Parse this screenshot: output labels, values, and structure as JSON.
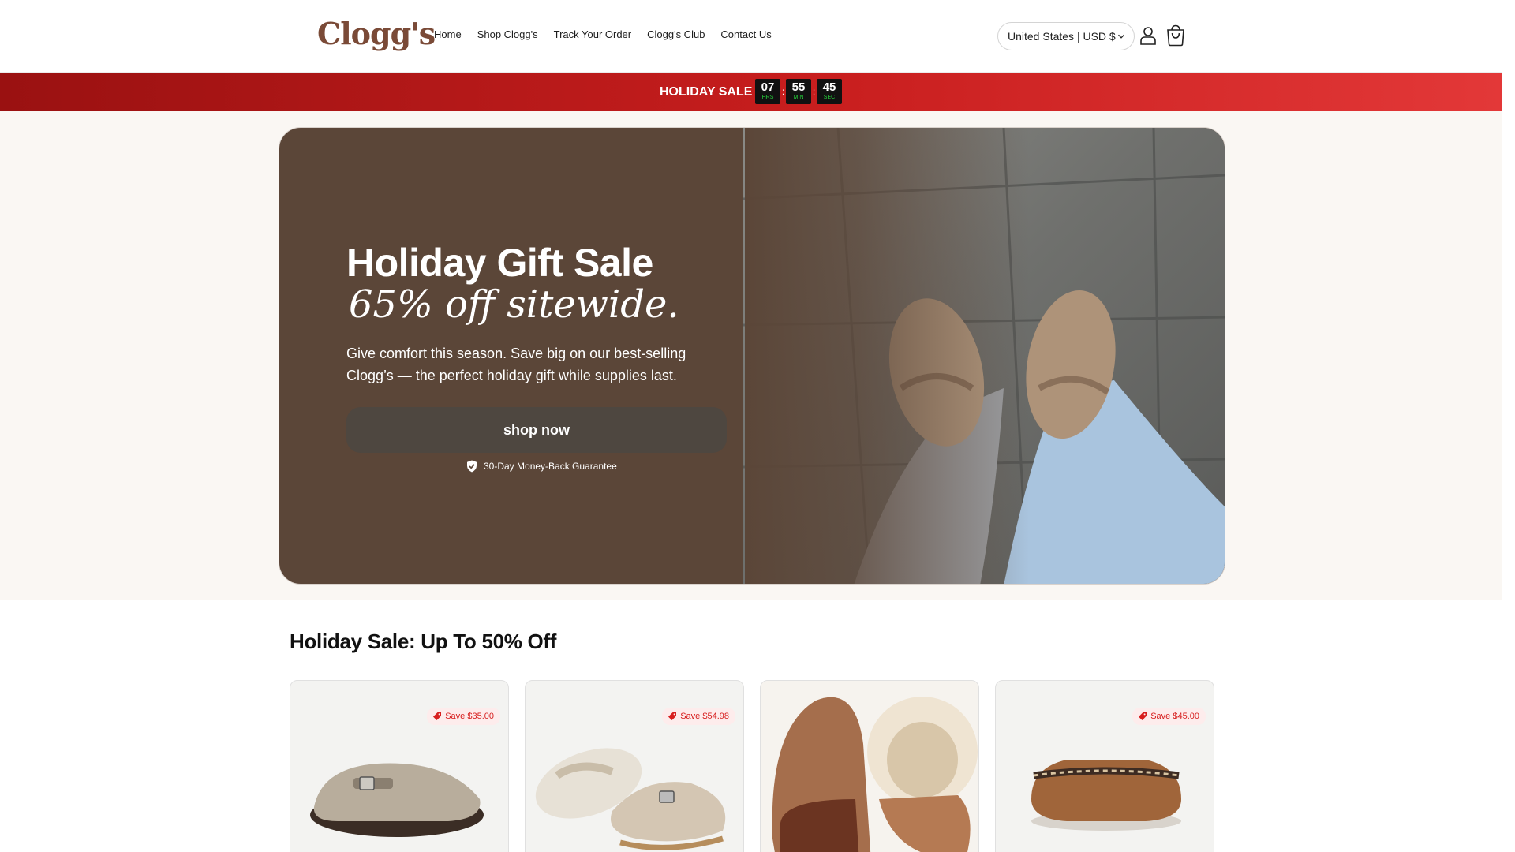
{
  "header": {
    "logo": "Clogg's",
    "nav": [
      "Home",
      "Shop Clogg's",
      "Track Your Order",
      "Clogg's Club",
      "Contact Us"
    ],
    "country_selector": "United States | USD $",
    "account_icon": "user-icon",
    "cart_icon": "shopping-bag-icon"
  },
  "sale_bar": {
    "label": "HOLIDAY SALE",
    "timer": [
      {
        "value": "07",
        "unit": "HRS"
      },
      {
        "value": "55",
        "unit": "MIN"
      },
      {
        "value": "45",
        "unit": "SEC"
      }
    ],
    "colors": {
      "bar_from": "#9a1111",
      "bar_to": "#e33838",
      "unit_text": "#27d23b"
    }
  },
  "hero": {
    "title": "Holiday Gift Sale",
    "subtitle": "65% off sitewide.",
    "description": "Give comfort this season. Save big on our best-selling Clogg’s — the perfect holiday gift while supplies last.",
    "button": "shop now",
    "guarantee": "30-Day Money-Back Guarantee",
    "colors": {
      "panel": "#5b4638"
    }
  },
  "products_section": {
    "title": "Holiday Sale: Up To 50% Off",
    "products": [
      {
        "badge": "Save $35.00",
        "image": "taupe-suede-clog"
      },
      {
        "badge": "Save $54.98",
        "image": "clog-pair-patterned-sole"
      },
      {
        "badge": "",
        "image": "shearling-slipper-pair"
      },
      {
        "badge": "Save $45.00",
        "image": "chestnut-braided-slipper"
      }
    ]
  },
  "brand_color": "#7a4a37",
  "sale_color": "#d71f1f"
}
